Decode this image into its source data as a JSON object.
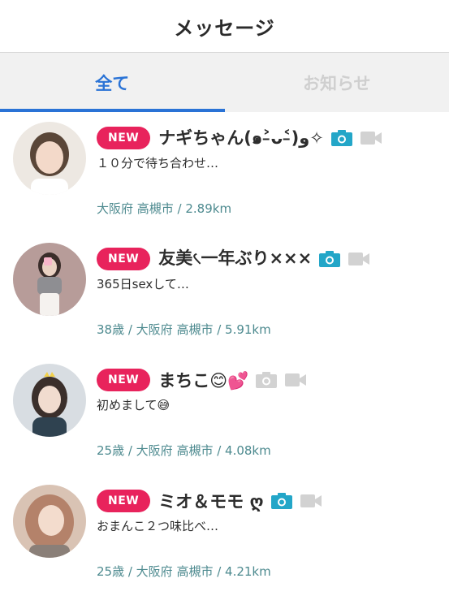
{
  "header": {
    "title": "メッセージ"
  },
  "tabs": [
    {
      "label": "全て",
      "active": true
    },
    {
      "label": "お知らせ",
      "active": false
    }
  ],
  "messages": [
    {
      "badge": "NEW",
      "name": "ナギちゃん(๑˃̵ᴗ˂̵)و✧",
      "preview": "１０分で待ち合わせ…",
      "meta": "大阪府 高槻市  / 2.89km",
      "photo_active": true,
      "video_active": false,
      "avatar_color": "#e9e3dc"
    },
    {
      "badge": "NEW",
      "name": "友美৻一年ぶり×××",
      "preview": "365日sexして…",
      "meta": "38歳 / 大阪府 高槻市  / 5.91km",
      "photo_active": true,
      "video_active": false,
      "avatar_color": "#c9a9a6"
    },
    {
      "badge": "NEW",
      "name": "まちこ😊💕",
      "preview": "初めまして😅",
      "meta": "25歳 / 大阪府 高槻市  / 4.08km",
      "photo_active": false,
      "video_active": false,
      "avatar_color": "#cfd4d8"
    },
    {
      "badge": "NEW",
      "name": "ミオ＆モモ ღ",
      "preview": "おまんこ２つ味比べ…",
      "meta": "25歳 / 大阪府 高槻市  / 4.21km",
      "photo_active": true,
      "video_active": false,
      "avatar_color": "#d8bfae"
    }
  ],
  "colors": {
    "accent": "#2a73d6",
    "badge": "#e8235c",
    "camera_active": "#23a6c8",
    "icon_inactive": "#cfcfcf",
    "meta": "#4d8a8f"
  }
}
